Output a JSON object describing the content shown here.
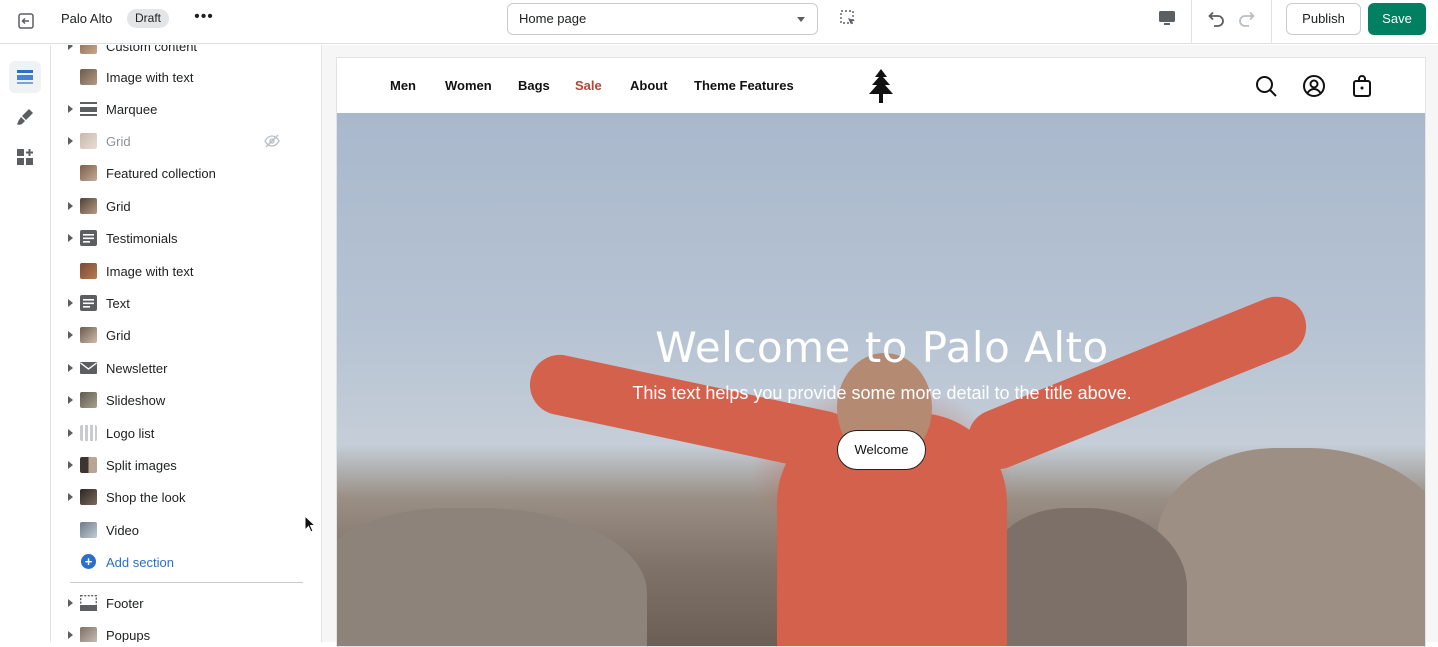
{
  "topbar": {
    "store_name": "Palo Alto",
    "status_badge": "Draft",
    "more_label": "•••",
    "page_select": "Home page",
    "publish_label": "Publish",
    "save_label": "Save",
    "save_color": "#008060"
  },
  "rail": {
    "items": [
      {
        "icon": "sections-icon",
        "active": true
      },
      {
        "icon": "theme-settings-brush-icon",
        "active": false
      },
      {
        "icon": "apps-blocks-icon",
        "active": false
      }
    ]
  },
  "sidebar": {
    "sections": [
      {
        "label": "Custom content",
        "expandable": true,
        "hidden": false,
        "thumb": "photo"
      },
      {
        "label": "Image with text",
        "expandable": false,
        "hidden": false,
        "thumb": "photo"
      },
      {
        "label": "Marquee",
        "expandable": true,
        "hidden": false,
        "thumb": "marquee"
      },
      {
        "label": "Grid",
        "expandable": true,
        "hidden": true,
        "thumb": "photo"
      },
      {
        "label": "Featured collection",
        "expandable": false,
        "hidden": false,
        "thumb": "photo"
      },
      {
        "label": "Grid",
        "expandable": true,
        "hidden": false,
        "thumb": "photo"
      },
      {
        "label": "Testimonials",
        "expandable": true,
        "hidden": false,
        "thumb": "text"
      },
      {
        "label": "Image with text",
        "expandable": false,
        "hidden": false,
        "thumb": "photo"
      },
      {
        "label": "Text",
        "expandable": true,
        "hidden": false,
        "thumb": "text"
      },
      {
        "label": "Grid",
        "expandable": true,
        "hidden": false,
        "thumb": "photo"
      },
      {
        "label": "Newsletter",
        "expandable": true,
        "hidden": false,
        "thumb": "mail"
      },
      {
        "label": "Slideshow",
        "expandable": true,
        "hidden": false,
        "thumb": "photo"
      },
      {
        "label": "Logo list",
        "expandable": true,
        "hidden": false,
        "thumb": "logos"
      },
      {
        "label": "Split images",
        "expandable": true,
        "hidden": false,
        "thumb": "photo"
      },
      {
        "label": "Shop the look",
        "expandable": true,
        "hidden": false,
        "thumb": "photo"
      },
      {
        "label": "Video",
        "expandable": false,
        "hidden": false,
        "thumb": "photo"
      }
    ],
    "add_section_label": "Add section",
    "footer_sections": [
      {
        "label": "Footer",
        "expandable": true,
        "thumb": "footer"
      },
      {
        "label": "Popups",
        "expandable": true,
        "thumb": "photo"
      }
    ]
  },
  "preview": {
    "nav_links": [
      "Men",
      "Women",
      "Bags",
      "Sale",
      "About",
      "Theme Features"
    ],
    "sale_color": "#b0463a",
    "hero_title": "Welcome to Palo Alto",
    "hero_subtitle": "This text helps you provide some more detail to the title above.",
    "hero_button": "Welcome"
  }
}
